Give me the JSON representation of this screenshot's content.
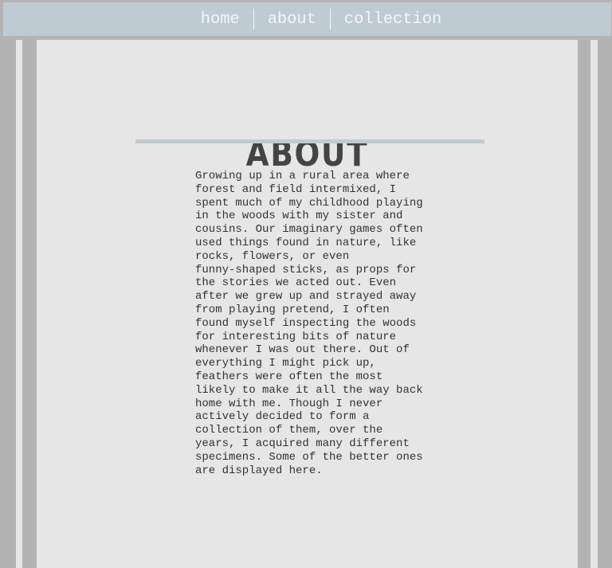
{
  "nav": {
    "items": [
      {
        "label": "home"
      },
      {
        "label": "about"
      },
      {
        "label": "collection"
      }
    ],
    "separator": "|"
  },
  "page": {
    "title": "ABOUT",
    "paragraph_lines": [
      "Growing up in a rural area where",
      "forest and field intermixed, I",
      "spent much of my childhood playing",
      "in the woods with my sister and",
      "cousins. Our imaginary games often",
      "used things found in nature, like",
      "rocks, flowers, or even",
      "funny-shaped sticks, as props for",
      "the stories we acted out. Even",
      "after we grew up and strayed away",
      "from playing pretend, I often",
      "found myself inspecting the woods",
      "for interesting bits of nature",
      "whenever I was out there. Out of",
      "everything I might pick up,",
      "feathers were often the most",
      "likely to make it all the way back",
      "home with me. Though I never",
      "actively decided to form a",
      "collection of them, over the",
      "years, I acquired many different",
      "specimens. Some of the better ones",
      "are displayed here."
    ]
  },
  "colors": {
    "nav_bg": "#bfcbd3",
    "page_bg": "#e6e6e6",
    "frame": "#b3b3b3",
    "text": "#333333"
  }
}
